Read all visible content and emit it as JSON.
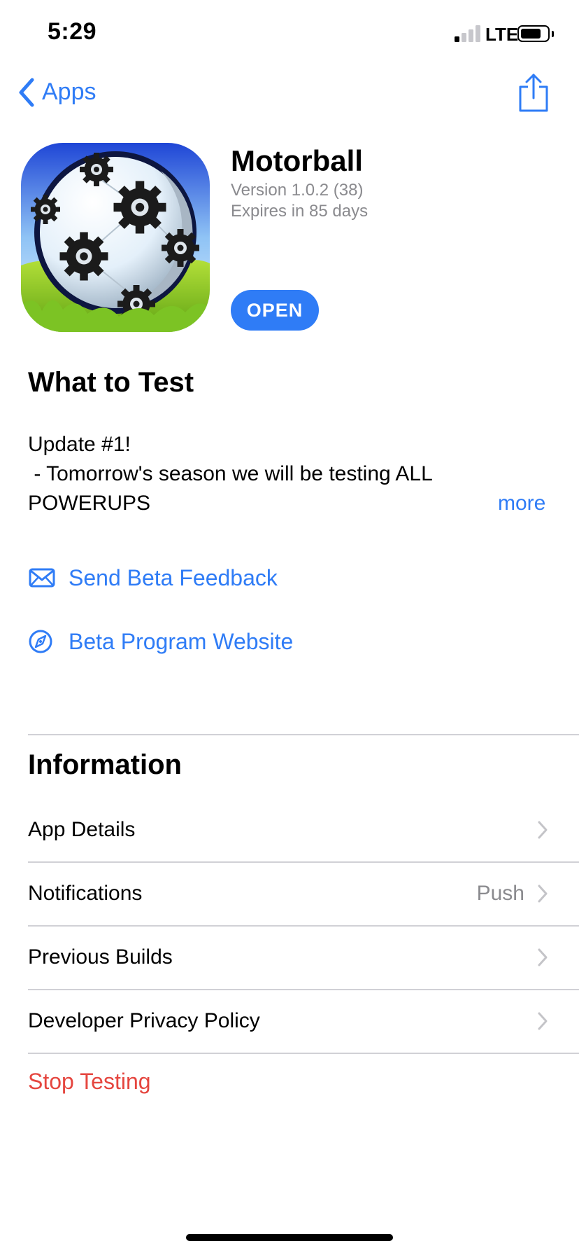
{
  "status_bar": {
    "time": "5:29",
    "network": "LTE",
    "signal_bars_active": 1,
    "signal_bars_total": 4,
    "battery_level": 0.8
  },
  "nav": {
    "back_label": "Apps",
    "back_icon": "chevron-left-icon",
    "share_icon": "share-icon"
  },
  "app": {
    "name": "Motorball",
    "version": "Version 1.0.2 (38)",
    "expires": "Expires in 85 days",
    "open_label": "OPEN",
    "icon": "soccer-ball-app-icon"
  },
  "what_to_test": {
    "title": "What to Test",
    "lines": [
      "Update #1!",
      " - Tomorrow's season we will be testing ALL",
      "POWERUPS"
    ],
    "more_label": "more"
  },
  "links": [
    {
      "label": "Send Beta Feedback",
      "icon": "envelope-icon"
    },
    {
      "label": "Beta Program Website",
      "icon": "compass-icon"
    }
  ],
  "information": {
    "title": "Information",
    "rows": [
      {
        "label": "App Details",
        "value": ""
      },
      {
        "label": "Notifications",
        "value": "Push"
      },
      {
        "label": "Previous Builds",
        "value": ""
      },
      {
        "label": "Developer Privacy Policy",
        "value": ""
      }
    ]
  },
  "stop_testing_label": "Stop Testing",
  "colors": {
    "accent": "#2f7cf6",
    "destructive": "#e5463f",
    "secondary_text": "#8a8a8e",
    "separator": "#d1d1d6"
  }
}
